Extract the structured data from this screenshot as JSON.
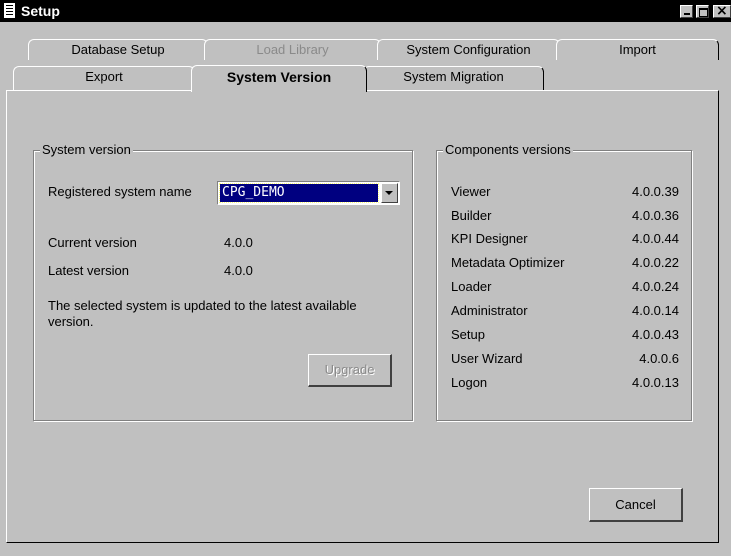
{
  "window": {
    "title": "Setup"
  },
  "tabs_row1": [
    {
      "label": "Database Setup",
      "disabled": false
    },
    {
      "label": "Load Library",
      "disabled": true
    },
    {
      "label": "System Configuration",
      "disabled": false
    },
    {
      "label": "Import",
      "disabled": false
    }
  ],
  "tabs_row2": [
    {
      "label": "Export",
      "active": false
    },
    {
      "label": "System Version",
      "active": true
    },
    {
      "label": "System Migration",
      "active": false
    }
  ],
  "system_version": {
    "group_title": "System version",
    "registered_label": "Registered system name",
    "registered_value": "CPG_DEMO",
    "current_label": "Current version",
    "current_value": "4.0.0",
    "latest_label": "Latest version",
    "latest_value": "4.0.0",
    "message": "The selected system is updated to the latest available version.",
    "upgrade_label": "Upgrade",
    "upgrade_enabled": false
  },
  "components": {
    "group_title": "Components versions",
    "items": [
      {
        "name": "Viewer",
        "version": "4.0.0.39"
      },
      {
        "name": "Builder",
        "version": "4.0.0.36"
      },
      {
        "name": "KPI Designer",
        "version": "4.0.0.44"
      },
      {
        "name": "Metadata Optimizer",
        "version": "4.0.0.22"
      },
      {
        "name": "Loader",
        "version": "4.0.0.24"
      },
      {
        "name": "Administrator",
        "version": "4.0.0.14"
      },
      {
        "name": "Setup",
        "version": "4.0.0.43"
      },
      {
        "name": "User Wizard",
        "version": "4.0.0.6"
      },
      {
        "name": "Logon",
        "version": "4.0.0.13"
      }
    ]
  },
  "cancel_label": "Cancel",
  "colors": {
    "titlebar": "#000000",
    "face": "#c0c0c0",
    "selection": "#000080",
    "disabled_text": "#8a8a8a"
  }
}
